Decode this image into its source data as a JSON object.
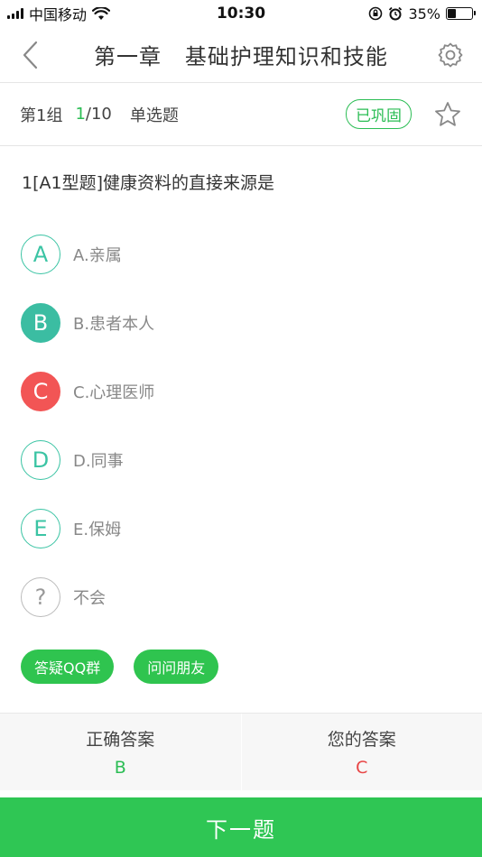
{
  "status": {
    "carrier": "中国移动",
    "time": "10:30",
    "battery": "35%",
    "battery_fraction": 0.35
  },
  "nav": {
    "title": "第一章   基础护理知识和技能"
  },
  "qbar": {
    "group": "第1组",
    "current": "1",
    "total": "/10",
    "type": "单选题",
    "tag": "已巩固"
  },
  "question": {
    "text": "1[A1型题]健康资料的直接来源是"
  },
  "options": [
    {
      "letter": "A",
      "text": "A.亲属",
      "state": "normal"
    },
    {
      "letter": "B",
      "text": "B.患者本人",
      "state": "correct"
    },
    {
      "letter": "C",
      "text": "C.心理医师",
      "state": "wrong"
    },
    {
      "letter": "D",
      "text": "D.同事",
      "state": "normal"
    },
    {
      "letter": "E",
      "text": "E.保姆",
      "state": "normal"
    },
    {
      "letter": "?",
      "text": "不会",
      "state": "unknown"
    }
  ],
  "actions": {
    "qq_group": "答疑QQ群",
    "ask_friends": "问问朋友"
  },
  "answers": {
    "correct_label": "正确答案",
    "correct_value": "B",
    "yours_label": "您的答案",
    "yours_value": "C"
  },
  "next": {
    "label": "下一题"
  },
  "colors": {
    "accent": "#2fc654",
    "option_outline": "#3bc4a4",
    "correct": "#3bbda2",
    "wrong": "#f25555"
  }
}
